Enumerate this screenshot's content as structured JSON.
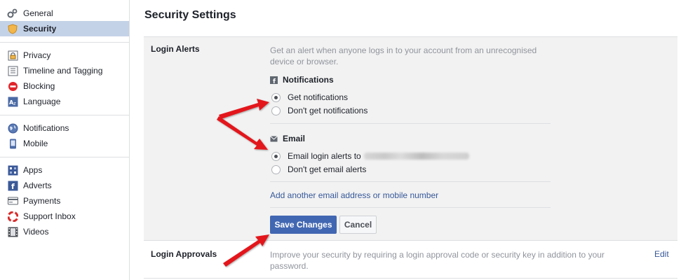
{
  "sidebar": {
    "groups": [
      [
        {
          "label": "General",
          "icon": "gears-icon"
        },
        {
          "label": "Security",
          "icon": "shield-icon",
          "selected": true
        }
      ],
      [
        {
          "label": "Privacy",
          "icon": "lock-icon"
        },
        {
          "label": "Timeline and Tagging",
          "icon": "timeline-icon"
        },
        {
          "label": "Blocking",
          "icon": "blocking-icon"
        },
        {
          "label": "Language",
          "icon": "language-icon"
        }
      ],
      [
        {
          "label": "Notifications",
          "icon": "globe-icon"
        },
        {
          "label": "Mobile",
          "icon": "mobile-icon"
        }
      ],
      [
        {
          "label": "Apps",
          "icon": "apps-icon"
        },
        {
          "label": "Adverts",
          "icon": "adverts-icon"
        },
        {
          "label": "Payments",
          "icon": "payments-icon"
        },
        {
          "label": "Support Inbox",
          "icon": "lifebuoy-icon"
        },
        {
          "label": "Videos",
          "icon": "film-icon"
        }
      ]
    ]
  },
  "main": {
    "title": "Security Settings",
    "login_alerts": {
      "title": "Login Alerts",
      "description": "Get an alert when anyone logs in to your account from an unrecognised device or browser.",
      "notifications": {
        "heading": "Notifications",
        "icon": "facebook-icon",
        "options": [
          "Get notifications",
          "Don't get notifications"
        ],
        "selected": 0
      },
      "email": {
        "heading": "Email",
        "icon": "envelope-icon",
        "options": [
          "Email login alerts to",
          "Don't get email alerts"
        ],
        "selected": 0
      },
      "add_link": "Add another email address or mobile number",
      "save_label": "Save Changes",
      "cancel_label": "Cancel"
    },
    "login_approvals": {
      "title": "Login Approvals",
      "description": "Improve your security by requiring a login approval code or security key in addition to your password.",
      "edit_label": "Edit"
    }
  },
  "colors": {
    "accent": "#4267b2",
    "link": "#365899",
    "selected_bg": "#c4d2e7",
    "panel_bg": "#f2f2f2",
    "arrow": "#e3151a"
  }
}
